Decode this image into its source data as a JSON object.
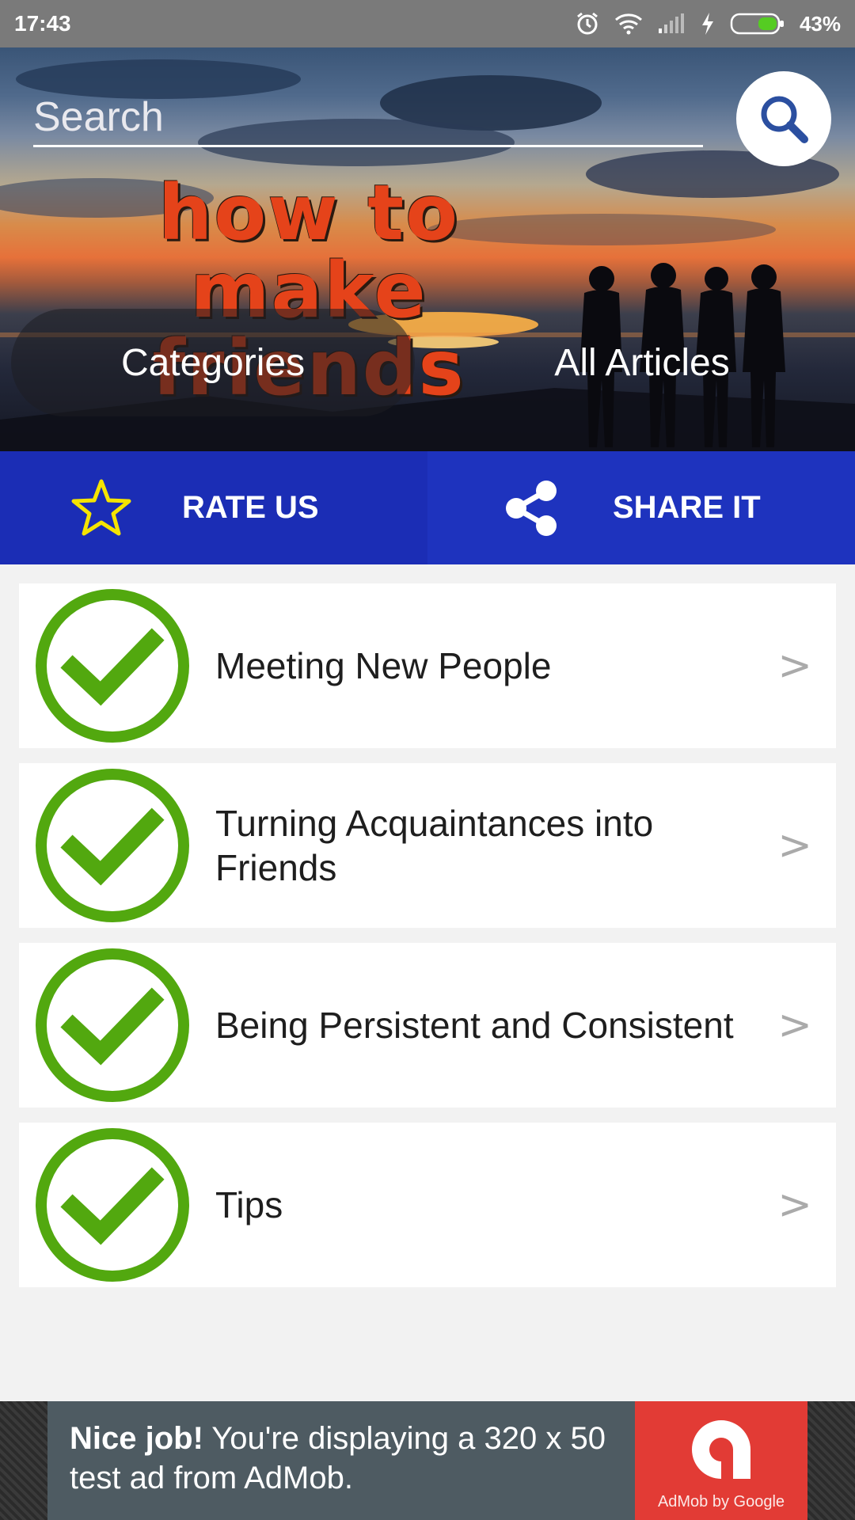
{
  "status_bar": {
    "time": "17:43",
    "battery_percent": "43%",
    "icons": [
      "alarm-icon",
      "wifi-icon",
      "signal-icon",
      "charging-icon",
      "battery-icon"
    ]
  },
  "header": {
    "search_placeholder": "Search",
    "logo_line1": "how to make",
    "logo_line2": "friends",
    "categories_label": "Categories",
    "all_articles_label": "All Articles"
  },
  "actions": {
    "rate_label": "RATE US",
    "share_label": "SHARE IT"
  },
  "list": {
    "items": [
      {
        "label": "Meeting New People",
        "chevron": ">"
      },
      {
        "label": "Turning Acquaintances into Friends",
        "chevron": ">"
      },
      {
        "label": "Being Persistent and Consistent",
        "chevron": ">"
      },
      {
        "label": "Tips",
        "chevron": ">"
      }
    ]
  },
  "ad": {
    "bold": "Nice job!",
    "text": " You're displaying a 320 x 50 test ad from AdMob.",
    "logo_caption": "AdMob by Google"
  },
  "colors": {
    "action_bar": "#1b2db5",
    "check_green": "#52a80f",
    "logo_orange": "#e5431a",
    "ad_red": "#e23b35"
  }
}
